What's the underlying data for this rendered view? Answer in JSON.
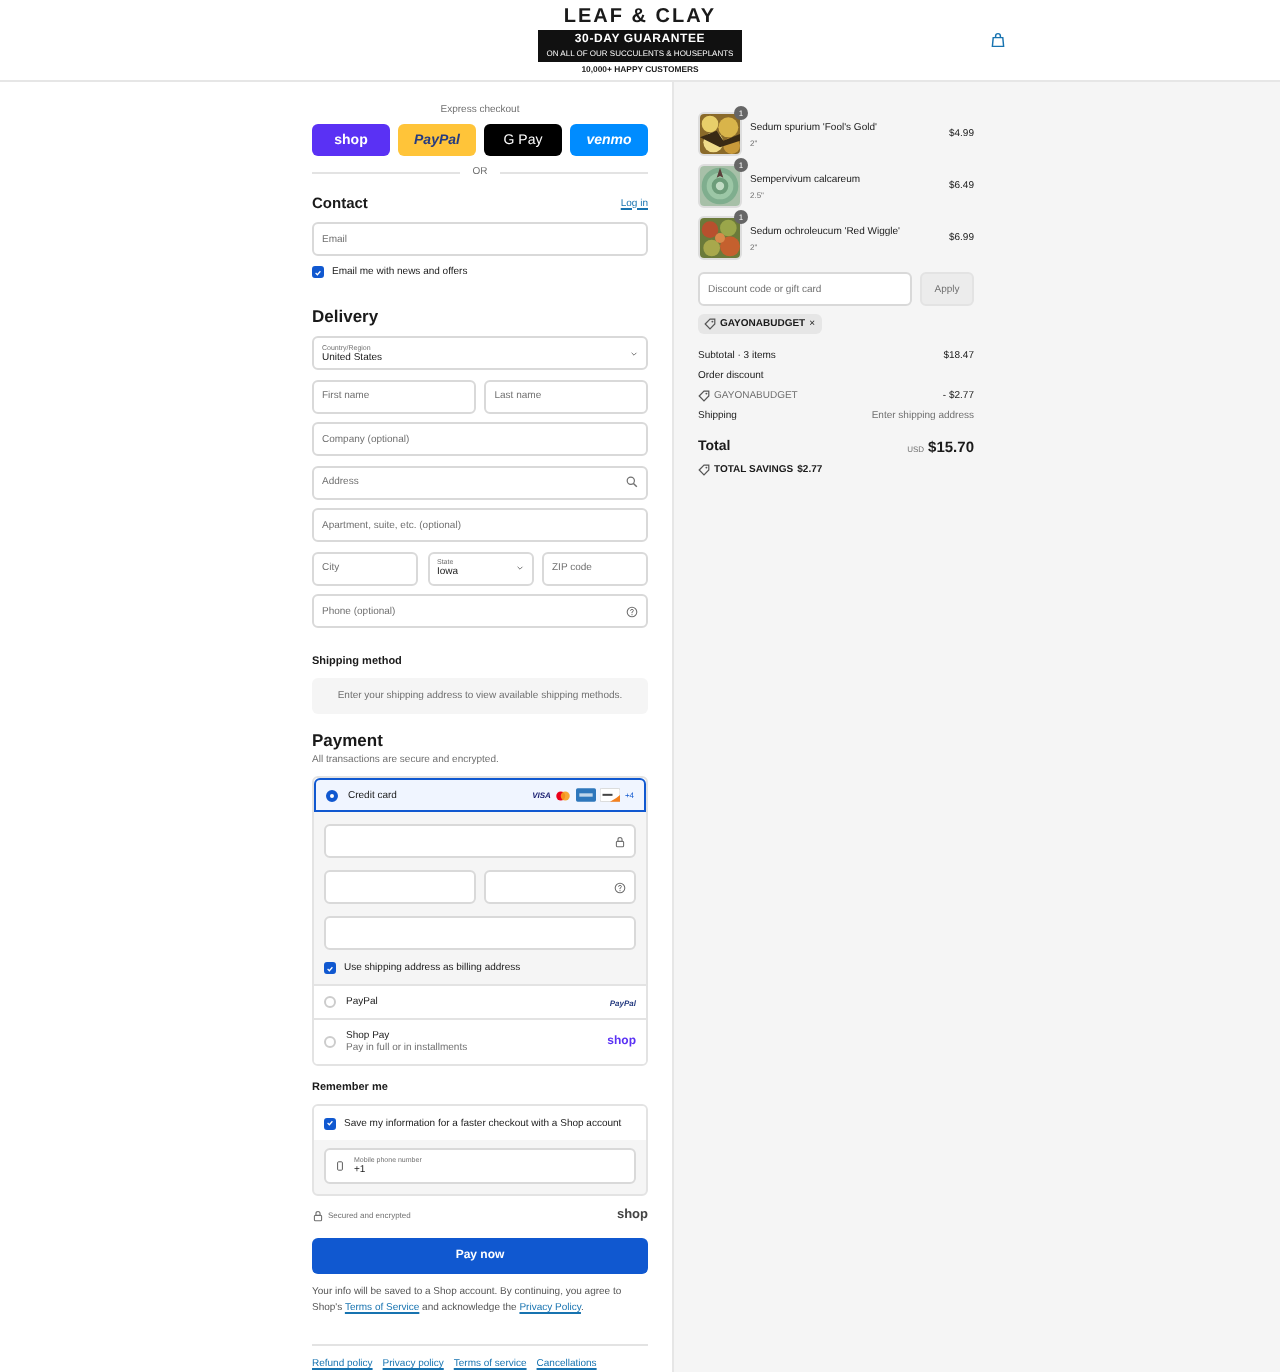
{
  "header": {
    "title": "LEAF & CLAY",
    "badge": "30-DAY GUARANTEE",
    "badge_note": "ON ALL OF OUR SUCCULENTS & HOUSEPLANTS",
    "tagline": "10,000+ HAPPY CUSTOMERS"
  },
  "express_checkout": {
    "title": "Express checkout",
    "buttons": [
      {
        "kind": "shop",
        "label": "shop"
      },
      {
        "kind": "paypal",
        "label": "PayPal"
      },
      {
        "kind": "gpay",
        "label": "G Pay"
      },
      {
        "kind": "venmo",
        "label": "venmo"
      }
    ],
    "divider": "OR"
  },
  "contact": {
    "title": "Contact",
    "link": "Log in",
    "email": {
      "placeholder": "Email"
    },
    "newsletter": {
      "label": "Email me with news and offers",
      "checked": true
    }
  },
  "delivery": {
    "title": "Delivery",
    "rows": [
      [
        {
          "kind": "select",
          "label": "Country/Region",
          "value": "United States"
        }
      ],
      [
        {
          "kind": "text",
          "placeholder": "First name"
        },
        {
          "kind": "text",
          "placeholder": "Last name"
        }
      ],
      [
        {
          "kind": "text",
          "placeholder": "Company (optional)"
        }
      ],
      [
        {
          "kind": "search",
          "placeholder": "Address"
        }
      ],
      [
        {
          "kind": "text",
          "placeholder": "Apartment, suite, etc. (optional)"
        }
      ],
      [
        {
          "kind": "text",
          "placeholder": "City"
        },
        {
          "kind": "select",
          "label": "State",
          "value": "Iowa"
        },
        {
          "kind": "text",
          "placeholder": "ZIP code"
        }
      ],
      [
        {
          "kind": "help",
          "placeholder": "Phone (optional)"
        }
      ]
    ]
  },
  "shipping_method": {
    "title": "Shipping method",
    "notice": "Enter your shipping address to view available shipping methods."
  },
  "payment": {
    "title": "Payment",
    "subtitle": "All transactions are secure and encrypted.",
    "methods": [
      {
        "kind": "card",
        "label": "Credit card",
        "selected": true,
        "brands": [
          {
            "kind": "visa",
            "label": "VISA"
          },
          {
            "kind": "mastercard"
          },
          {
            "kind": "amex"
          },
          {
            "kind": "discover"
          }
        ],
        "more": "+4",
        "billing": {
          "label": "Use shipping address as billing address",
          "checked": true
        }
      },
      {
        "kind": "paypal",
        "label": "PayPal",
        "logo": "PayPal",
        "selected": false
      },
      {
        "kind": "shop",
        "label": "Shop Pay",
        "note": "Pay in full or in installments",
        "logo": "shop",
        "selected": false
      }
    ]
  },
  "remember_me": {
    "title": "Remember me",
    "save": {
      "label": "Save my information for a faster checkout with a Shop account",
      "checked": true
    },
    "phone": {
      "label": "Mobile phone number",
      "value": "+1"
    },
    "secure_note": "Secured and encrypted",
    "logo": "shop"
  },
  "pay_button": "Pay now",
  "legal": {
    "before": "Your info will be saved to a Shop account. By continuing, you agree to Shop's ",
    "terms": "Terms of Service",
    "middle": " and acknowledge the ",
    "privacy": "Privacy Policy",
    "after": "."
  },
  "footer_links": [
    "Refund policy",
    "Privacy policy",
    "Terms of service",
    "Cancellations"
  ],
  "order": {
    "items": [
      {
        "name": "Sedum spurium 'Fool's Gold'",
        "variant": "2\"",
        "quantity": "1",
        "price": "$4.99"
      },
      {
        "name": "Sempervivum calcareum",
        "variant": "2.5\"",
        "quantity": "1",
        "price": "$6.49"
      },
      {
        "name": "Sedum ochroleucum 'Red Wiggle'",
        "variant": "2\"",
        "quantity": "1",
        "price": "$6.99"
      }
    ],
    "discount": {
      "placeholder": "Discount code or gift card",
      "button": "Apply",
      "applied": [
        {
          "code": "GAYONABUDGET",
          "remove": "×"
        }
      ]
    },
    "summary": {
      "subtotal_label": "Subtotal · 3 items",
      "subtotal": "$18.47",
      "discount_label": "Order discount",
      "discount_code": "GAYONABUDGET",
      "discount_value": "- $2.77",
      "shipping_label": "Shipping",
      "shipping_value": "Enter shipping address",
      "total_label": "Total",
      "currency": "USD",
      "total": "$15.70",
      "savings_label": "TOTAL SAVINGS",
      "savings": "$2.77"
    }
  }
}
